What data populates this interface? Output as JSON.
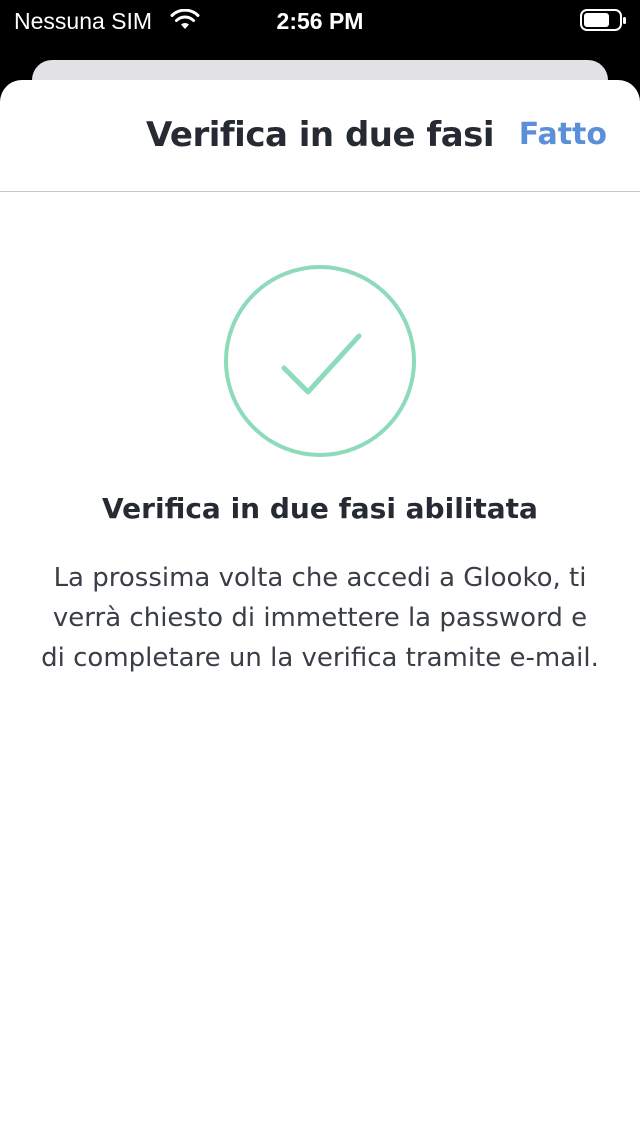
{
  "status_bar": {
    "carrier": "Nessuna SIM",
    "time": "2:56 PM",
    "wifi_icon": "wifi-icon",
    "battery_icon": "battery-icon"
  },
  "nav": {
    "title": "Verifica in due fasi",
    "done_label": "Fatto"
  },
  "content": {
    "status_icon": "check-circle-icon",
    "heading": "Verifica in due fasi abilitata",
    "body": "La prossima volta che accedi a Glooko, ti verrà chiesto di immettere la password e di completare un la verifica tramite e-mail."
  },
  "colors": {
    "accent": "#5b8fd9",
    "success": "#8ddbbb",
    "text": "#262a33"
  }
}
